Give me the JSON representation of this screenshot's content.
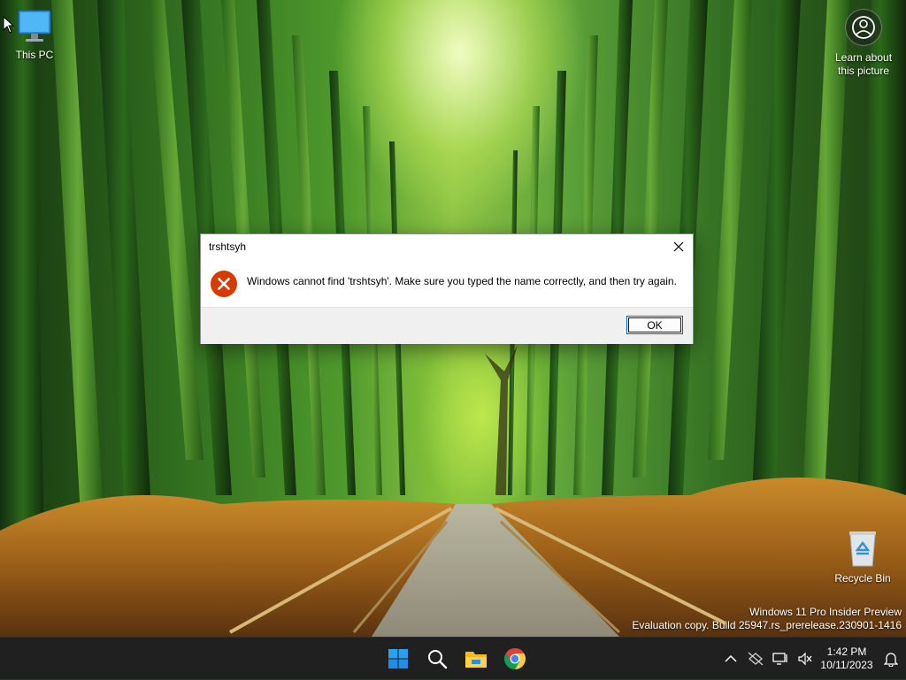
{
  "desktop": {
    "icons": [
      {
        "label": "This PC",
        "icon": "computer-monitor-icon"
      },
      {
        "label": "Recycle Bin",
        "icon": "recycle-bin-icon"
      }
    ],
    "spotlight": {
      "line1": "Learn about",
      "line2": "this picture",
      "icon": "camera-lens-icon"
    },
    "watermark": {
      "line1": "Windows 11 Pro Insider Preview",
      "line2": "Evaluation copy. Build 25947.rs_prerelease.230901-1416"
    }
  },
  "dialog": {
    "title": "trshtsyh",
    "message": "Windows cannot find 'trshtsyh'. Make sure you typed the name correctly, and then try again.",
    "ok_label": "OK",
    "icon": "error-icon",
    "accent": "#d83b01"
  },
  "taskbar": {
    "apps": [
      {
        "name": "start",
        "icon": "windows-logo-icon"
      },
      {
        "name": "search",
        "icon": "search-icon"
      },
      {
        "name": "file-explorer",
        "icon": "folder-icon"
      },
      {
        "name": "chrome",
        "icon": "chrome-icon"
      }
    ],
    "clock": {
      "time": "1:42 PM",
      "date": "10/11/2023"
    },
    "colors": {
      "background": "#202020",
      "windows_blue": "#1e90ff"
    }
  }
}
